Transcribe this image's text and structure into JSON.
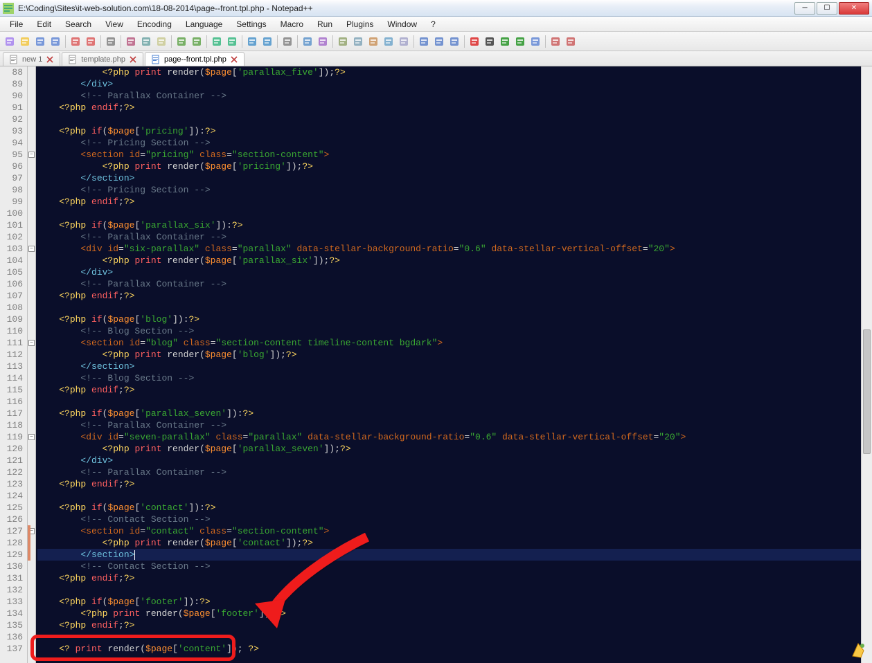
{
  "window": {
    "title": "E:\\Coding\\Sites\\it-web-solution.com\\18-08-2014\\page--front.tpl.php - Notepad++"
  },
  "menu": [
    "File",
    "Edit",
    "Search",
    "View",
    "Encoding",
    "Language",
    "Settings",
    "Macro",
    "Run",
    "Plugins",
    "Window",
    "?"
  ],
  "tabs": [
    {
      "label": "new  1",
      "active": false
    },
    {
      "label": "template.php",
      "active": false
    },
    {
      "label": "page--front.tpl.php",
      "active": true
    }
  ],
  "lines": [
    {
      "n": 88,
      "ind": 3,
      "seg": [
        [
          "php",
          "<?php "
        ],
        [
          "kw",
          "print "
        ],
        [
          "fn",
          "render"
        ],
        [
          "pun",
          "("
        ],
        [
          "var",
          "$page"
        ],
        [
          "pun",
          "["
        ],
        [
          "key",
          "'parallax_five'"
        ],
        [
          "pun",
          "]);"
        ],
        [
          "php",
          "?>"
        ]
      ]
    },
    {
      "n": 89,
      "ind": 2,
      "seg": [
        [
          "end",
          "</div>"
        ]
      ]
    },
    {
      "n": 90,
      "ind": 2,
      "seg": [
        [
          "cmt",
          "<!-- Parallax Container -->"
        ]
      ]
    },
    {
      "n": 91,
      "ind": 1,
      "seg": [
        [
          "php",
          "<?php "
        ],
        [
          "kw",
          "endif"
        ],
        [
          "pun",
          ";"
        ],
        [
          "php",
          "?>"
        ]
      ]
    },
    {
      "n": 92,
      "ind": 0,
      "seg": []
    },
    {
      "n": 93,
      "ind": 1,
      "seg": [
        [
          "php",
          "<?php "
        ],
        [
          "kw",
          "if"
        ],
        [
          "pun",
          "("
        ],
        [
          "var",
          "$page"
        ],
        [
          "pun",
          "["
        ],
        [
          "key",
          "'pricing'"
        ],
        [
          "pun",
          "]):"
        ],
        [
          "php",
          "?>"
        ]
      ]
    },
    {
      "n": 94,
      "ind": 2,
      "seg": [
        [
          "cmt",
          "<!-- Pricing Section -->"
        ]
      ]
    },
    {
      "n": 95,
      "ind": 2,
      "fold": "-",
      "seg": [
        [
          "tag",
          "<section "
        ],
        [
          "attr",
          "id"
        ],
        [
          "pun",
          "="
        ],
        [
          "str",
          "\"pricing\""
        ],
        [
          "tag",
          " "
        ],
        [
          "attr",
          "class"
        ],
        [
          "pun",
          "="
        ],
        [
          "str",
          "\"section-content\""
        ],
        [
          "tag",
          ">"
        ]
      ]
    },
    {
      "n": 96,
      "ind": 3,
      "seg": [
        [
          "php",
          "<?php "
        ],
        [
          "kw",
          "print "
        ],
        [
          "fn",
          "render"
        ],
        [
          "pun",
          "("
        ],
        [
          "var",
          "$page"
        ],
        [
          "pun",
          "["
        ],
        [
          "key",
          "'pricing'"
        ],
        [
          "pun",
          "]);"
        ],
        [
          "php",
          "?>"
        ]
      ]
    },
    {
      "n": 97,
      "ind": 2,
      "seg": [
        [
          "end",
          "</section>"
        ]
      ]
    },
    {
      "n": 98,
      "ind": 2,
      "seg": [
        [
          "cmt",
          "<!-- Pricing Section -->"
        ]
      ]
    },
    {
      "n": 99,
      "ind": 1,
      "seg": [
        [
          "php",
          "<?php "
        ],
        [
          "kw",
          "endif"
        ],
        [
          "pun",
          ";"
        ],
        [
          "php",
          "?>"
        ]
      ]
    },
    {
      "n": 100,
      "ind": 0,
      "seg": []
    },
    {
      "n": 101,
      "ind": 1,
      "seg": [
        [
          "php",
          "<?php "
        ],
        [
          "kw",
          "if"
        ],
        [
          "pun",
          "("
        ],
        [
          "var",
          "$page"
        ],
        [
          "pun",
          "["
        ],
        [
          "key",
          "'parallax_six'"
        ],
        [
          "pun",
          "]):"
        ],
        [
          "php",
          "?>"
        ]
      ]
    },
    {
      "n": 102,
      "ind": 2,
      "seg": [
        [
          "cmt",
          "<!-- Parallax Container -->"
        ]
      ]
    },
    {
      "n": 103,
      "ind": 2,
      "fold": "-",
      "seg": [
        [
          "tag",
          "<div "
        ],
        [
          "attr",
          "id"
        ],
        [
          "pun",
          "="
        ],
        [
          "str",
          "\"six-parallax\""
        ],
        [
          "tag",
          " "
        ],
        [
          "attr",
          "class"
        ],
        [
          "pun",
          "="
        ],
        [
          "str",
          "\"parallax\""
        ],
        [
          "tag",
          " "
        ],
        [
          "attr",
          "data-stellar-background-ratio"
        ],
        [
          "pun",
          "="
        ],
        [
          "str",
          "\"0.6\""
        ],
        [
          "tag",
          " "
        ],
        [
          "attr",
          "data-stellar-vertical-offset"
        ],
        [
          "pun",
          "="
        ],
        [
          "str",
          "\"20\""
        ],
        [
          "tag",
          ">"
        ]
      ]
    },
    {
      "n": 104,
      "ind": 3,
      "seg": [
        [
          "php",
          "<?php "
        ],
        [
          "kw",
          "print "
        ],
        [
          "fn",
          "render"
        ],
        [
          "pun",
          "("
        ],
        [
          "var",
          "$page"
        ],
        [
          "pun",
          "["
        ],
        [
          "key",
          "'parallax_six'"
        ],
        [
          "pun",
          "]);"
        ],
        [
          "php",
          "?>"
        ]
      ]
    },
    {
      "n": 105,
      "ind": 2,
      "seg": [
        [
          "end",
          "</div>"
        ]
      ]
    },
    {
      "n": 106,
      "ind": 2,
      "seg": [
        [
          "cmt",
          "<!-- Parallax Container -->"
        ]
      ]
    },
    {
      "n": 107,
      "ind": 1,
      "seg": [
        [
          "php",
          "<?php "
        ],
        [
          "kw",
          "endif"
        ],
        [
          "pun",
          ";"
        ],
        [
          "php",
          "?>"
        ]
      ]
    },
    {
      "n": 108,
      "ind": 0,
      "seg": []
    },
    {
      "n": 109,
      "ind": 1,
      "seg": [
        [
          "php",
          "<?php "
        ],
        [
          "kw",
          "if"
        ],
        [
          "pun",
          "("
        ],
        [
          "var",
          "$page"
        ],
        [
          "pun",
          "["
        ],
        [
          "key",
          "'blog'"
        ],
        [
          "pun",
          "]):"
        ],
        [
          "php",
          "?>"
        ]
      ]
    },
    {
      "n": 110,
      "ind": 2,
      "seg": [
        [
          "cmt",
          "<!-- Blog Section -->"
        ]
      ]
    },
    {
      "n": 111,
      "ind": 2,
      "fold": "-",
      "seg": [
        [
          "tag",
          "<section "
        ],
        [
          "attr",
          "id"
        ],
        [
          "pun",
          "="
        ],
        [
          "str",
          "\"blog\""
        ],
        [
          "tag",
          " "
        ],
        [
          "attr",
          "class"
        ],
        [
          "pun",
          "="
        ],
        [
          "str",
          "\"section-content timeline-content bgdark\""
        ],
        [
          "tag",
          ">"
        ]
      ]
    },
    {
      "n": 112,
      "ind": 3,
      "seg": [
        [
          "php",
          "<?php "
        ],
        [
          "kw",
          "print "
        ],
        [
          "fn",
          "render"
        ],
        [
          "pun",
          "("
        ],
        [
          "var",
          "$page"
        ],
        [
          "pun",
          "["
        ],
        [
          "key",
          "'blog'"
        ],
        [
          "pun",
          "]);"
        ],
        [
          "php",
          "?>"
        ]
      ]
    },
    {
      "n": 113,
      "ind": 2,
      "seg": [
        [
          "end",
          "</section>"
        ]
      ]
    },
    {
      "n": 114,
      "ind": 2,
      "seg": [
        [
          "cmt",
          "<!-- Blog Section -->"
        ]
      ]
    },
    {
      "n": 115,
      "ind": 1,
      "seg": [
        [
          "php",
          "<?php "
        ],
        [
          "kw",
          "endif"
        ],
        [
          "pun",
          ";"
        ],
        [
          "php",
          "?>"
        ]
      ]
    },
    {
      "n": 116,
      "ind": 0,
      "seg": []
    },
    {
      "n": 117,
      "ind": 1,
      "seg": [
        [
          "php",
          "<?php "
        ],
        [
          "kw",
          "if"
        ],
        [
          "pun",
          "("
        ],
        [
          "var",
          "$page"
        ],
        [
          "pun",
          "["
        ],
        [
          "key",
          "'parallax_seven'"
        ],
        [
          "pun",
          "]):"
        ],
        [
          "php",
          "?>"
        ]
      ]
    },
    {
      "n": 118,
      "ind": 2,
      "seg": [
        [
          "cmt",
          "<!-- Parallax Container -->"
        ]
      ]
    },
    {
      "n": 119,
      "ind": 2,
      "fold": "-",
      "seg": [
        [
          "tag",
          "<div "
        ],
        [
          "attr",
          "id"
        ],
        [
          "pun",
          "="
        ],
        [
          "str",
          "\"seven-parallax\""
        ],
        [
          "tag",
          " "
        ],
        [
          "attr",
          "class"
        ],
        [
          "pun",
          "="
        ],
        [
          "str",
          "\"parallax\""
        ],
        [
          "tag",
          " "
        ],
        [
          "attr",
          "data-stellar-background-ratio"
        ],
        [
          "pun",
          "="
        ],
        [
          "str",
          "\"0.6\""
        ],
        [
          "tag",
          " "
        ],
        [
          "attr",
          "data-stellar-vertical-offset"
        ],
        [
          "pun",
          "="
        ],
        [
          "str",
          "\"20\""
        ],
        [
          "tag",
          ">"
        ]
      ]
    },
    {
      "n": 120,
      "ind": 3,
      "seg": [
        [
          "php",
          "<?php "
        ],
        [
          "kw",
          "print "
        ],
        [
          "fn",
          "render"
        ],
        [
          "pun",
          "("
        ],
        [
          "var",
          "$page"
        ],
        [
          "pun",
          "["
        ],
        [
          "key",
          "'parallax_seven'"
        ],
        [
          "pun",
          "]);"
        ],
        [
          "php",
          "?>"
        ]
      ]
    },
    {
      "n": 121,
      "ind": 2,
      "seg": [
        [
          "end",
          "</div>"
        ]
      ]
    },
    {
      "n": 122,
      "ind": 2,
      "seg": [
        [
          "cmt",
          "<!-- Parallax Container -->"
        ]
      ]
    },
    {
      "n": 123,
      "ind": 1,
      "seg": [
        [
          "php",
          "<?php "
        ],
        [
          "kw",
          "endif"
        ],
        [
          "pun",
          ";"
        ],
        [
          "php",
          "?>"
        ]
      ]
    },
    {
      "n": 124,
      "ind": 0,
      "seg": []
    },
    {
      "n": 125,
      "ind": 1,
      "seg": [
        [
          "php",
          "<?php "
        ],
        [
          "kw",
          "if"
        ],
        [
          "pun",
          "("
        ],
        [
          "var",
          "$page"
        ],
        [
          "pun",
          "["
        ],
        [
          "key",
          "'contact'"
        ],
        [
          "pun",
          "]):"
        ],
        [
          "php",
          "?>"
        ]
      ]
    },
    {
      "n": 126,
      "ind": 2,
      "seg": [
        [
          "cmt",
          "<!-- Contact Section -->"
        ]
      ]
    },
    {
      "n": 127,
      "ind": 2,
      "fold": "-",
      "change": true,
      "seg": [
        [
          "tag",
          "<section "
        ],
        [
          "attr",
          "id"
        ],
        [
          "pun",
          "="
        ],
        [
          "str",
          "\"contact\""
        ],
        [
          "tag",
          " "
        ],
        [
          "attr",
          "class"
        ],
        [
          "pun",
          "="
        ],
        [
          "str",
          "\"section-content\""
        ],
        [
          "tag",
          ">"
        ]
      ]
    },
    {
      "n": 128,
      "ind": 3,
      "change": true,
      "seg": [
        [
          "php",
          "<?php "
        ],
        [
          "kw",
          "print "
        ],
        [
          "fn",
          "render"
        ],
        [
          "pun",
          "("
        ],
        [
          "var",
          "$page"
        ],
        [
          "pun",
          "["
        ],
        [
          "key",
          "'contact'"
        ],
        [
          "pun",
          "]);"
        ],
        [
          "php",
          "?>"
        ]
      ]
    },
    {
      "n": 129,
      "ind": 2,
      "hl": true,
      "change": true,
      "seg": [
        [
          "end",
          "</section>"
        ],
        [
          "cursor",
          ""
        ]
      ]
    },
    {
      "n": 130,
      "ind": 2,
      "seg": [
        [
          "cmt",
          "<!-- Contact Section -->"
        ]
      ]
    },
    {
      "n": 131,
      "ind": 1,
      "seg": [
        [
          "php",
          "<?php "
        ],
        [
          "kw",
          "endif"
        ],
        [
          "pun",
          ";"
        ],
        [
          "php",
          "?>"
        ]
      ]
    },
    {
      "n": 132,
      "ind": 0,
      "seg": []
    },
    {
      "n": 133,
      "ind": 1,
      "seg": [
        [
          "php",
          "<?php "
        ],
        [
          "kw",
          "if"
        ],
        [
          "pun",
          "("
        ],
        [
          "var",
          "$page"
        ],
        [
          "pun",
          "["
        ],
        [
          "key",
          "'footer'"
        ],
        [
          "pun",
          "]):"
        ],
        [
          "php",
          "?>"
        ]
      ]
    },
    {
      "n": 134,
      "ind": 2,
      "seg": [
        [
          "php",
          "<?php "
        ],
        [
          "kw",
          "print "
        ],
        [
          "fn",
          "render"
        ],
        [
          "pun",
          "("
        ],
        [
          "var",
          "$page"
        ],
        [
          "pun",
          "["
        ],
        [
          "key",
          "'footer'"
        ],
        [
          "pun",
          "]);"
        ],
        [
          "php",
          "?>"
        ]
      ]
    },
    {
      "n": 135,
      "ind": 1,
      "seg": [
        [
          "php",
          "<?php "
        ],
        [
          "kw",
          "endif"
        ],
        [
          "pun",
          ";"
        ],
        [
          "php",
          "?>"
        ]
      ]
    },
    {
      "n": 136,
      "ind": 0,
      "seg": []
    },
    {
      "n": 137,
      "ind": 1,
      "seg": [
        [
          "php",
          "<? "
        ],
        [
          "kw",
          "print "
        ],
        [
          "fn",
          "render"
        ],
        [
          "pun",
          "("
        ],
        [
          "var",
          "$page"
        ],
        [
          "pun",
          "["
        ],
        [
          "key",
          "'content'"
        ],
        [
          "pun",
          "]); "
        ],
        [
          "php",
          "?>"
        ]
      ]
    }
  ],
  "toolbar_icons": [
    "new-file",
    "open-file",
    "save",
    "save-all",
    "sep",
    "close",
    "close-all",
    "sep",
    "print",
    "sep",
    "cut",
    "copy",
    "paste",
    "sep",
    "undo",
    "redo",
    "sep",
    "find",
    "replace",
    "sep",
    "zoom-in",
    "zoom-out",
    "sep",
    "sync",
    "sep",
    "word-wrap",
    "show-all",
    "sep",
    "indent-guide",
    "fold",
    "user-lang",
    "doc-map",
    "func-list",
    "sep",
    "toggle-1",
    "toggle-2",
    "toggle-3",
    "sep",
    "record",
    "stop",
    "play",
    "play-multi",
    "save-macro",
    "sep",
    "spell-check",
    "spell-toggle"
  ]
}
